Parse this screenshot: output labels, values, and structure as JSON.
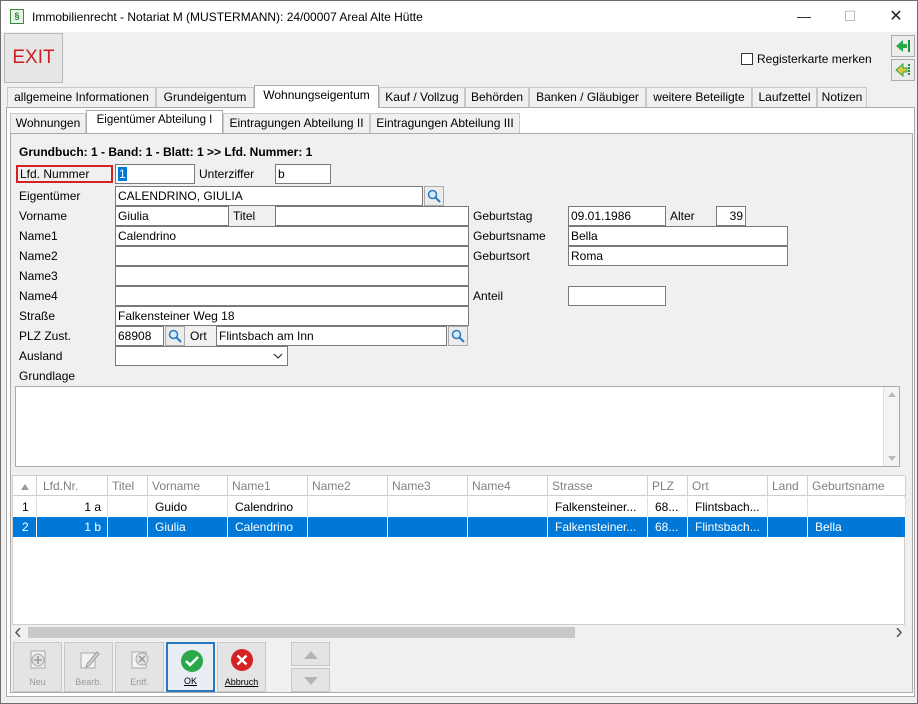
{
  "window": {
    "title": "Immobilienrecht - Notariat M (MUSTERMANN): 24/00007 Areal Alte Hütte",
    "minimize": "—",
    "maximize": "☐",
    "close": "✕"
  },
  "toolbar": {
    "exit_label": "EXIT",
    "register_label": "Registerkarte merken",
    "register_checked": false
  },
  "main_tabs": [
    "allgemeine Informationen",
    "Grundeigentum",
    "Wohnungseigentum",
    "Kauf / Vollzug",
    "Behörden",
    "Banken / Gläubiger",
    "weitere Beteiligte",
    "Laufzettel",
    "Notizen"
  ],
  "active_main_tab": "Wohnungseigentum",
  "sub_tabs": [
    "Wohnungen",
    "Eigentümer Abteilung I",
    "Eintragungen Abteilung II",
    "Eintragungen Abteilung III"
  ],
  "active_sub_tab": "Eigentümer Abteilung I",
  "form": {
    "header": "Grundbuch: 1 - Band: 1 - Blatt: 1 >> Lfd. Nummer: 1",
    "lfd_nummer_label": "Lfd. Nummer",
    "lfd_nummer": "1",
    "unterziffer_label": "Unterziffer",
    "unterziffer": "b",
    "eigentuemer_label": "Eigentümer",
    "eigentuemer": "CALENDRINO, GIULIA",
    "vorname_label": "Vorname",
    "vorname": "Giulia",
    "titel_label": "Titel",
    "titel": "",
    "geburtstag_label": "Geburtstag",
    "geburtstag": "09.01.1986",
    "alter_label": "Alter",
    "alter": "39",
    "name1_label": "Name1",
    "name1": "Calendrino",
    "geburtsname_label": "Geburtsname",
    "geburtsname": "Bella",
    "name2_label": "Name2",
    "name2": "",
    "geburtsort_label": "Geburtsort",
    "geburtsort": "Roma",
    "name3_label": "Name3",
    "name3": "",
    "name4_label": "Name4",
    "name4": "",
    "anteil_label": "Anteil",
    "anteil": "",
    "strasse_label": "Straße",
    "strasse": "Falkensteiner Weg 18",
    "plz_label": "PLZ Zust.",
    "plz": "68908",
    "ort_label": "Ort",
    "ort": "Flintsbach am Inn",
    "ausland_label": "Ausland",
    "ausland": "",
    "grundlage_label": "Grundlage",
    "grundlage": ""
  },
  "grid": {
    "columns": [
      "Lfd.Nr.",
      "Titel",
      "Vorname",
      "Name1",
      "Name2",
      "Name3",
      "Name4",
      "Strasse",
      "PLZ",
      "Ort",
      "Land",
      "Geburtsname"
    ],
    "rows": [
      {
        "idx": "1",
        "lfd": "1 a",
        "titel": "",
        "vorname": "Guido",
        "name1": "Calendrino",
        "name2": "",
        "name3": "",
        "name4": "",
        "strasse": "Falkensteiner...",
        "plz": "68...",
        "ort": "Flintsbach...",
        "land": "",
        "geburtsname": "",
        "selected": false
      },
      {
        "idx": "2",
        "lfd": "1 b",
        "titel": "",
        "vorname": "Giulia",
        "name1": "Calendrino",
        "name2": "",
        "name3": "",
        "name4": "",
        "strasse": "Falkensteiner...",
        "plz": "68...",
        "ort": "Flintsbach...",
        "land": "",
        "geburtsname": "Bella",
        "selected": true
      }
    ]
  },
  "buttons": {
    "neu": "Neu",
    "bearb": "Bearb.",
    "entf": "Entf.",
    "ok": "OK",
    "abbruch": "Abbruch"
  },
  "colors": {
    "selection": "#0078d7",
    "exit_text": "#cc1f1f",
    "ok_green": "#2aa84a",
    "cancel_red": "#d42222",
    "highlight_border": "#d42222"
  }
}
